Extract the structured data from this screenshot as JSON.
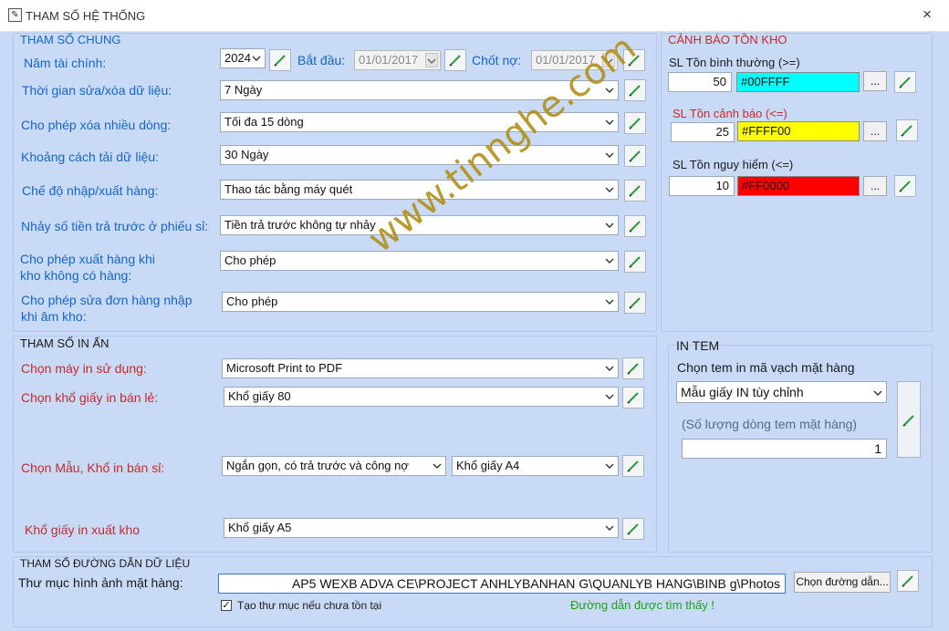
{
  "window": {
    "title": "THAM SỐ HỆ THỐNG",
    "close": "×"
  },
  "general": {
    "title": "THAM SỐ CHUNG",
    "fiscal_year_label": "Năm tài chính:",
    "fiscal_year_value": "2024",
    "start_label": "Bắt đầu:",
    "start_value": "01/01/2017",
    "close_debt_label": "Chốt nợ:",
    "close_debt_value": "01/01/2017",
    "edit_time_label": "Thời gian sửa/xóa dữ liệu:",
    "edit_time_value": "7 Ngày",
    "multi_delete_label": "Cho phép xóa nhiều dòng:",
    "multi_delete_value": "Tối đa 15 dòng",
    "load_distance_label": "Khoảng cách tải dữ liệu:",
    "load_distance_value": "30 Ngày",
    "io_mode_label": "Chế độ nhập/xuất hàng:",
    "io_mode_value": "Thao tác bằng máy quét",
    "prepay_label": "Nhảy số tiền trả trước ở phiếu sỉ:",
    "prepay_value": "Tiền trả trước không tự nhảy",
    "export_no_stock_label_1": "Cho phép xuất hàng khi",
    "export_no_stock_label_2": "kho không có hàng:",
    "export_no_stock_value": "Cho phép",
    "edit_import_label_1": "Cho phép sửa đơn hàng nhập",
    "edit_import_label_2": "khi âm kho:",
    "edit_import_value": "Cho phép"
  },
  "stock_warning": {
    "title": "CẢNH BÁO TỒN KHO",
    "normal_label": "SL Tồn bình thường (>=)",
    "normal_qty": "50",
    "normal_color": "#00FFFF",
    "warn_label": "SL Tồn cảnh báo (<=)",
    "warn_qty": "25",
    "warn_color": "#FFFF00",
    "danger_label": "SL Tồn nguy hiểm (<=)",
    "danger_qty": "10",
    "danger_color": "#FF0000",
    "picker_label": "..."
  },
  "print": {
    "title": "THAM SỐ IN ẤN",
    "printer_label": "Chọn máy in sử dụng:",
    "printer_value": "Microsoft Print to PDF",
    "retail_paper_label": "Chọn khổ giấy in bán lẻ:",
    "retail_paper_value": "Khổ giấy 80",
    "wholesale_label": "Chọn Mẫu, Khổ in bán sỉ:",
    "wholesale_template_value": "Ngắn gọn, có trả trước và công nợ",
    "wholesale_paper_value": "Khổ giấy A4",
    "export_paper_label": "Khổ giấy in xuất kho",
    "export_paper_value": "Khổ giấy A5"
  },
  "tem": {
    "title": "IN TEM",
    "choose_label": "Chọn tem in mã vạch mặt hàng",
    "template_value": "Mẫu giấy IN tùy chỉnh",
    "rows_label": "(Số lượng dòng tem mặt hàng)",
    "rows_value": "1"
  },
  "path": {
    "title": "THAM SỐ ĐƯỜNG DẪN DỮ LIỆU",
    "folder_label": "Thư mục hình ảnh mặt hàng:",
    "folder_value": "AP5  WEXB   ADVA  CE\\PROJECT  ANHLYBANHAN  G\\QUANLYB  HANG\\BINB  g\\Photos",
    "choose_button": "Chọn đường dẫn...",
    "create_folder_label": "Tạo thư mục nếu chưa tồn tại",
    "create_folder_checked": "✓",
    "found_message": "Đường dẫn được tìm thấy !"
  },
  "watermark": "www.tinnghe.com",
  "colors": {
    "accent_blue": "#1565c9",
    "label_red": "#c42b2b",
    "found_green": "#1aa31a",
    "pen_green": "#2e9a3e"
  }
}
